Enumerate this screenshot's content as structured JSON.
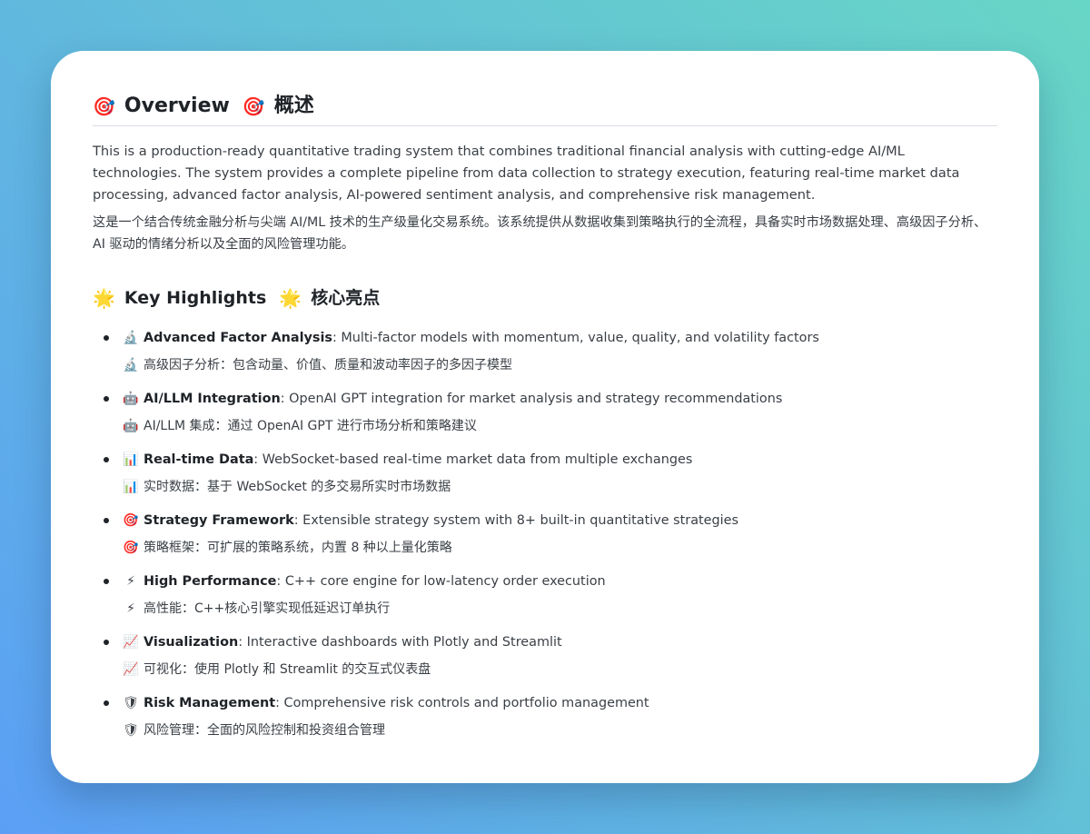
{
  "overview": {
    "icon": "🎯",
    "title_en": "Overview",
    "title_zh": "概述",
    "paragraph_en": "This is a production-ready quantitative trading system that combines traditional financial analysis with cutting-edge AI/ML technologies. The system provides a complete pipeline from data collection to strategy execution, featuring real-time market data processing, advanced factor analysis, AI-powered sentiment analysis, and comprehensive risk management.",
    "paragraph_zh": "这是一个结合传统金融分析与尖端 AI/ML 技术的生产级量化交易系统。该系统提供从数据收集到策略执行的全流程，具备实时市场数据处理、高级因子分析、AI 驱动的情绪分析以及全面的风险管理功能。"
  },
  "highlights": {
    "icon": "🌟",
    "title_en": "Key Highlights",
    "title_zh": "核心亮点",
    "items": [
      {
        "icon": "🔬",
        "label": "Advanced Factor Analysis",
        "desc": ": Multi-factor models with momentum, value, quality, and volatility factors",
        "zh": "高级因子分析：包含动量、价值、质量和波动率因子的多因子模型"
      },
      {
        "icon": "🤖",
        "label": "AI/LLM Integration",
        "desc": ": OpenAI GPT integration for market analysis and strategy recommendations",
        "zh": "AI/LLM 集成：通过 OpenAI GPT 进行市场分析和策略建议"
      },
      {
        "icon": "📊",
        "label": "Real-time Data",
        "desc": ": WebSocket-based real-time market data from multiple exchanges",
        "zh": "实时数据：基于 WebSocket 的多交易所实时市场数据"
      },
      {
        "icon": "🎯",
        "label": "Strategy Framework",
        "desc": ": Extensible strategy system with 8+ built-in quantitative strategies",
        "zh": "策略框架：可扩展的策略系统，内置 8 种以上量化策略"
      },
      {
        "icon": "⚡",
        "label": "High Performance",
        "desc": ": C++ core engine for low-latency order execution",
        "zh": "高性能：C++核心引擎实现低延迟订单执行"
      },
      {
        "icon": "📈",
        "label": "Visualization",
        "desc": ": Interactive dashboards with Plotly and Streamlit",
        "zh": "可视化：使用 Plotly 和 Streamlit 的交互式仪表盘"
      },
      {
        "icon": "🛡",
        "label": "Risk Management",
        "desc": ": Comprehensive risk controls and portfolio management",
        "zh": "风险管理：全面的风险控制和投资组合管理"
      }
    ]
  }
}
